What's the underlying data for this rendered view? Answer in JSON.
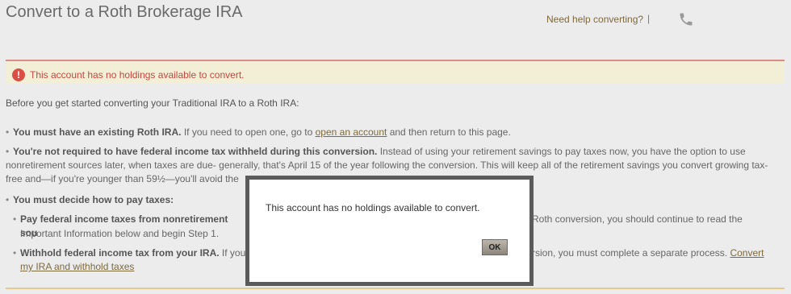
{
  "header": {
    "title": "Convert to a Roth Brokerage IRA",
    "help_link": "Need help converting?",
    "separator": "|",
    "phone_icon": "phone-icon"
  },
  "alert": {
    "icon": "alert-icon",
    "icon_glyph": "!",
    "message": "This account has no holdings available to convert.",
    "colors": {
      "background": "#f3efd6",
      "text": "#c4473f",
      "border": "#d98a8a"
    }
  },
  "main": {
    "intro": "Before you get started converting your Traditional IRA to a Roth IRA:",
    "bullet1": {
      "bold": "You must have an existing Roth IRA.",
      "text_before_link": " If you need to open one, go to ",
      "link": "open an account",
      "text_after_link": " and then return to this page."
    },
    "bullet2": {
      "bold": "You're not required to have federal income tax withheld during this conversion.",
      "line1_rest": " Instead of using your retirement savings to pay taxes now, you have the option to use",
      "line2": "nonretirement sources later, when taxes are due- generally, that's April 15 of the year following the conversion. This will keep all of the retirement savings you convert growing tax-",
      "line3": "free and—if you're younger than 59½—you'll avoid the"
    },
    "bullet3": {
      "bold": "You must decide how to pay taxes:"
    },
    "sub1": {
      "bold": "Pay federal income taxes from nonretirement sou",
      "line1_right": "Roth conversion, you should continue to read the",
      "line2": "Important Information below and begin Step 1."
    },
    "sub2": {
      "bold": "Withhold federal income tax from your IRA.",
      "line1_mid": " If you",
      "line1_right": "rsion, you must complete a separate process. ",
      "link_part1": "Convert",
      "link_part2": "my IRA and withhold taxes"
    }
  },
  "dialog": {
    "message": "This account has no holdings available to convert.",
    "ok_label": "OK"
  },
  "colors": {
    "accent": "#7d6a3e",
    "page_bg": "#ececec"
  }
}
